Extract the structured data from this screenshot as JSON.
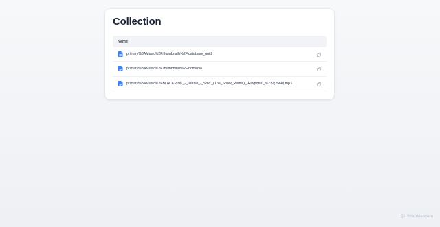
{
  "card": {
    "title": "Collection",
    "table": {
      "header": "Name",
      "rows": [
        {
          "name": "primary%3AMusic%2F.thumbnails%2F.database_uuid",
          "icon": "file-icon"
        },
        {
          "name": "primary%3AMusic%2F.thumbnails%2F.nomedia",
          "icon": "file-icon"
        },
        {
          "name": "primary%3AMusic%2FBLACKPINK_-_Jennie_-_Solo'_(The_Show_Remix)_-Ringtone'_%232(256k).mp3",
          "icon": "file-icon"
        }
      ]
    }
  },
  "watermark": {
    "text": "ScanMalware"
  },
  "colors": {
    "accent": "#3b82f6",
    "text": "#1b2535"
  }
}
